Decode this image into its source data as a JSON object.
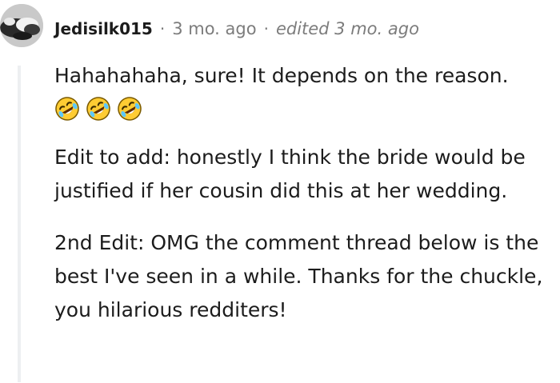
{
  "comment": {
    "author": "Jedisilk015",
    "separator": "·",
    "timestamp": "3 mo. ago",
    "edited": "edited 3 mo. ago",
    "paragraphs": [
      "Hahahahaha, sure! It depends on the reason.",
      "Edit to add: honestly I think the bride would be justified if her cousin did this at her wedding.",
      "2nd Edit: OMG the comment thread below is the best I've seen in a while. Thanks for the chuckle, you hilarious redditers!"
    ],
    "emojis": [
      "rofl-emoji",
      "rofl-emoji",
      "rofl-emoji"
    ]
  },
  "colors": {
    "text": "#1c1c1c",
    "meta": "#7c7c7c",
    "thread_line": "#edeff1",
    "emoji_face": "#ffcc33"
  }
}
